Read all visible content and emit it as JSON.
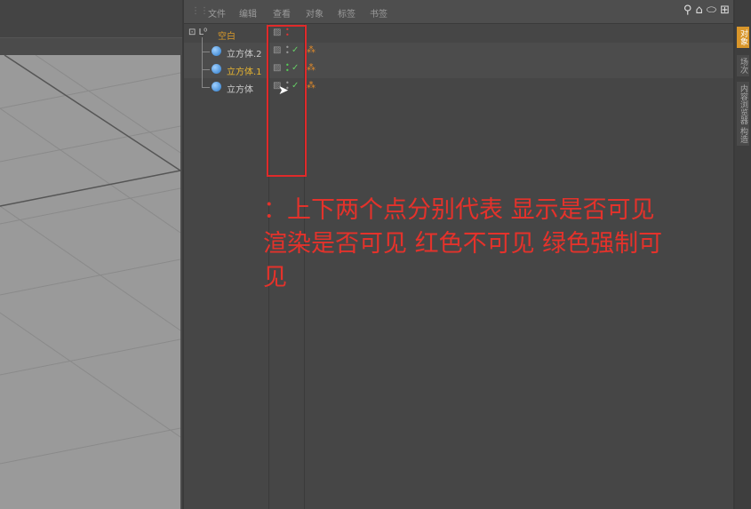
{
  "menu": [
    "文件",
    "编辑",
    "查看",
    "对象",
    "标签",
    "书签"
  ],
  "objects": [
    {
      "name": "空白",
      "color": "#d99a2a"
    },
    {
      "name": "立方体.2",
      "color": "#cccccc"
    },
    {
      "name": "立方体.1",
      "color": "#e8b530"
    },
    {
      "name": "立方体",
      "color": "#cccccc"
    }
  ],
  "side_tabs": [
    "对象",
    "场次",
    "内容浏览器",
    "构造"
  ],
  "annotation": "：上下两个点分别代表  显示是否可见 渲染是否可见  红色不可见  绿色强制可见",
  "viewport_icons": "✥⇣⊙⊓",
  "tool_icons": "⚲ ⌂ ⬭ ⊞"
}
